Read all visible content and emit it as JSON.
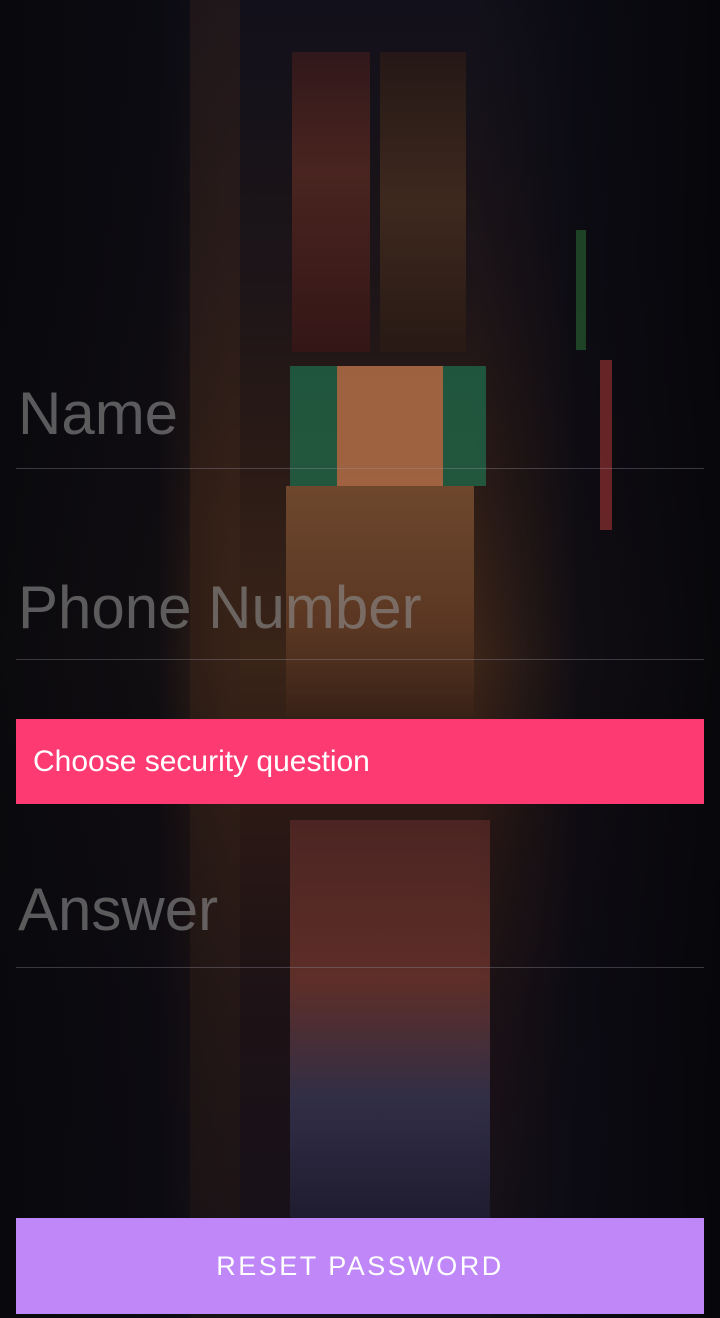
{
  "form": {
    "name_placeholder": "Name",
    "phone_placeholder": "Phone Number",
    "security_question_label": "Choose security question",
    "answer_placeholder": "Answer",
    "reset_button_label": "RESET PASSWORD"
  },
  "colors": {
    "security_select_bg": "#fe3a72",
    "reset_button_bg": "#bf87f7",
    "placeholder_text": "#8c8c8c"
  }
}
